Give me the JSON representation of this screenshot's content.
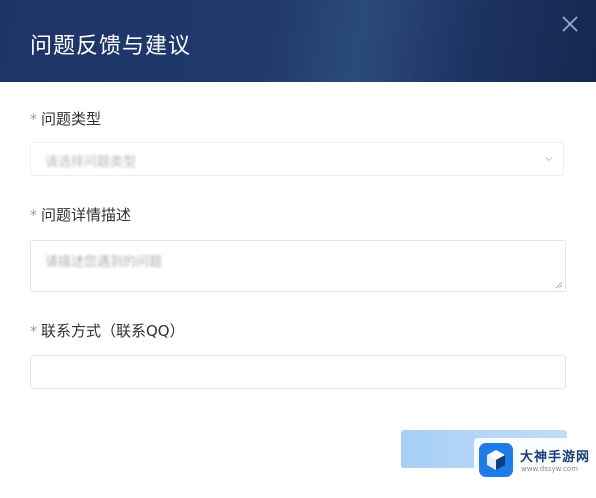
{
  "dialog": {
    "title": "问题反馈与建议"
  },
  "form": {
    "required_mark": "*",
    "type": {
      "label": "问题类型",
      "placeholder": "请选择问题类型"
    },
    "detail": {
      "label": "问题详情描述",
      "placeholder": "请描述您遇到的问题"
    },
    "contact": {
      "label": "联系方式（联系QQ）",
      "value": ""
    }
  },
  "watermark": {
    "title": "大神手游网",
    "url": "www.dssyw.com"
  },
  "colors": {
    "header": "#1d3566",
    "button": "#a6cff5",
    "logo": "#1f7ce6"
  }
}
